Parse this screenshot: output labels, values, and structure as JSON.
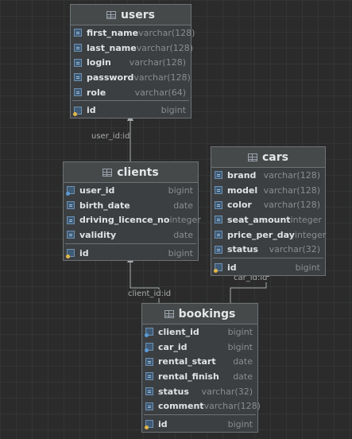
{
  "tables": {
    "users": {
      "name": "users",
      "columns": [
        {
          "name": "first_name",
          "type": "varchar(128)",
          "icon": "column-icon"
        },
        {
          "name": "last_name",
          "type": "varchar(128)",
          "icon": "column-icon"
        },
        {
          "name": "login",
          "type": "varchar(128)",
          "icon": "column-icon"
        },
        {
          "name": "password",
          "type": "varchar(128)",
          "icon": "column-icon"
        },
        {
          "name": "role",
          "type": "varchar(64)",
          "icon": "column-icon"
        }
      ],
      "keys": [
        {
          "name": "id",
          "type": "bigint",
          "icon": "primary-key-icon"
        }
      ]
    },
    "clients": {
      "name": "clients",
      "columns": [
        {
          "name": "user_id",
          "type": "bigint",
          "icon": "foreign-key-icon"
        },
        {
          "name": "birth_date",
          "type": "date",
          "icon": "column-icon"
        },
        {
          "name": "driving_licence_no",
          "type": "integer",
          "icon": "column-icon"
        },
        {
          "name": "validity",
          "type": "date",
          "icon": "column-icon"
        }
      ],
      "keys": [
        {
          "name": "id",
          "type": "bigint",
          "icon": "primary-key-icon"
        }
      ]
    },
    "cars": {
      "name": "cars",
      "columns": [
        {
          "name": "brand",
          "type": "varchar(128)",
          "icon": "column-icon"
        },
        {
          "name": "model",
          "type": "varchar(128)",
          "icon": "column-icon"
        },
        {
          "name": "color",
          "type": "varchar(128)",
          "icon": "column-icon"
        },
        {
          "name": "seat_amount",
          "type": "integer",
          "icon": "column-icon"
        },
        {
          "name": "price_per_day",
          "type": "integer",
          "icon": "column-icon"
        },
        {
          "name": "status",
          "type": "varchar(32)",
          "icon": "column-icon"
        }
      ],
      "keys": [
        {
          "name": "id",
          "type": "bigint",
          "icon": "primary-key-icon"
        }
      ]
    },
    "bookings": {
      "name": "bookings",
      "columns": [
        {
          "name": "client_id",
          "type": "bigint",
          "icon": "foreign-key-icon"
        },
        {
          "name": "car_id",
          "type": "bigint",
          "icon": "foreign-key-icon"
        },
        {
          "name": "rental_start",
          "type": "date",
          "icon": "column-icon"
        },
        {
          "name": "rental_finish",
          "type": "date",
          "icon": "column-icon"
        },
        {
          "name": "status",
          "type": "varchar(32)",
          "icon": "column-icon"
        },
        {
          "name": "comment",
          "type": "varchar(128)",
          "icon": "column-icon"
        }
      ],
      "keys": [
        {
          "name": "id",
          "type": "bigint",
          "icon": "primary-key-icon"
        }
      ]
    }
  },
  "relations": [
    {
      "label": "user_id:id"
    },
    {
      "label": "client_id:id"
    },
    {
      "label": "car_id:id"
    }
  ],
  "colors": {
    "background": "#2b2b2b",
    "table_fill": "#3c3f41",
    "border": "#6e7275",
    "connector": "#a9acaf"
  }
}
